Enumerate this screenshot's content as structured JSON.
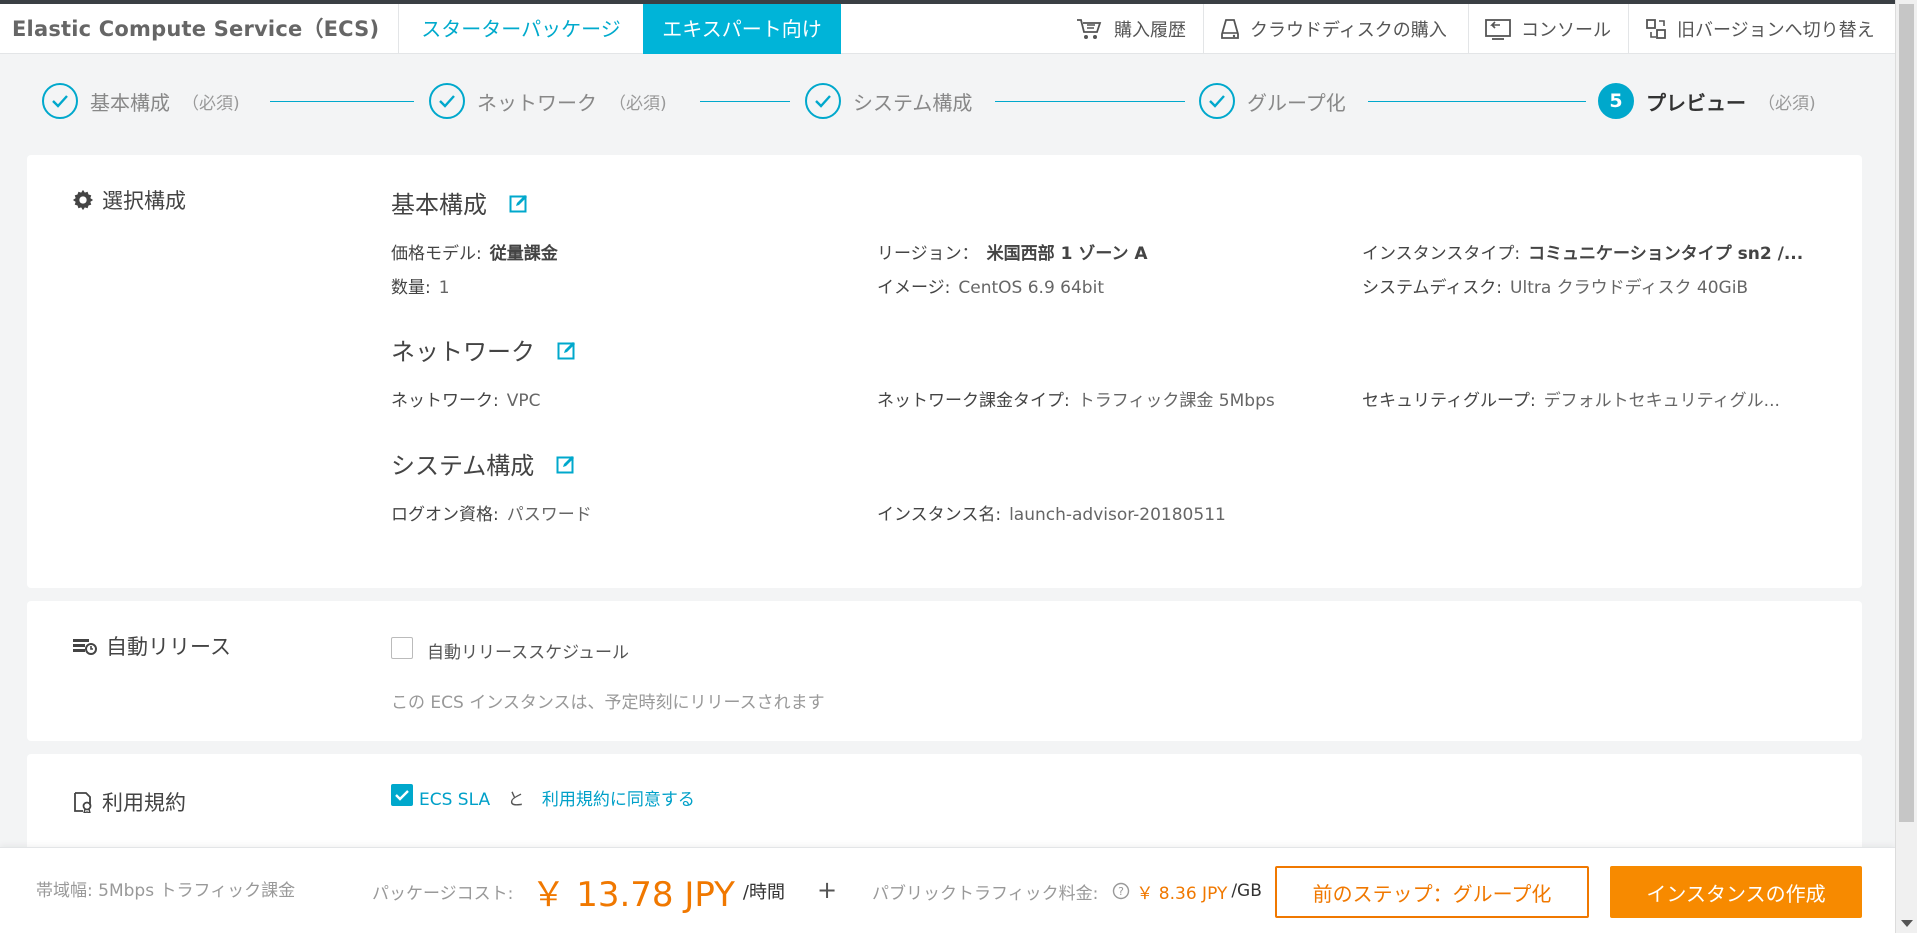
{
  "header": {
    "brand": "Elastic Compute Service（ECS)",
    "tab_starter": "スターターパッケージ",
    "tab_expert": "エキスパート向け",
    "nav_history": "購入履歴",
    "nav_disk": "クラウドディスクの購入",
    "nav_console": "コンソール",
    "nav_oldver": "旧バージョンへ切り替え"
  },
  "steps": [
    {
      "label": "基本構成",
      "req": "（必須)",
      "state": "done"
    },
    {
      "label": "ネットワーク",
      "req": "（必須)",
      "state": "done"
    },
    {
      "label": "システム構成",
      "req": "",
      "state": "done"
    },
    {
      "label": "グループ化",
      "req": "",
      "state": "done"
    },
    {
      "number": "5",
      "label": "プレビュー",
      "req": "（必須)",
      "state": "active"
    }
  ],
  "selected": {
    "title": "選択構成",
    "basic": {
      "title": "基本構成",
      "price_model_label": "価格モデル:",
      "price_model_value": "従量課金",
      "region_label": "リージョン：",
      "region_value": "米国西部 1 ゾーン A",
      "instance_type_label": "インスタンスタイプ:",
      "instance_type_value": "コミュニケーションタイプ sn2 /...",
      "quantity_label": "数量:",
      "quantity_value": "1",
      "image_label": "イメージ:",
      "image_value": "CentOS 6.9 64bit",
      "system_disk_label": "システムディスク:",
      "system_disk_value": "Ultra クラウドディスク 40GiB"
    },
    "network": {
      "title": "ネットワーク",
      "network_label": "ネットワーク:",
      "network_value": "VPC",
      "billing_label": "ネットワーク課金タイプ:",
      "billing_value": "トラフィック課金 5Mbps",
      "security_label": "セキュリティグループ:",
      "security_value": "デフォルトセキュリティグル..."
    },
    "system": {
      "title": "システム構成",
      "logon_label": "ログオン資格:",
      "logon_value": "パスワード",
      "instance_name_label": "インスタンス名:",
      "instance_name_value": "launch-advisor-20180511"
    }
  },
  "auto_release": {
    "title": "自動リリース",
    "checkbox_label": "自動リリーススケジュール",
    "checked": false,
    "note": "この ECS インスタンスは、予定時刻にリリースされます"
  },
  "terms": {
    "title": "利用規約",
    "checked": true,
    "sla_link": "ECS SLA",
    "and": "と",
    "terms_link": "利用規約に同意する"
  },
  "footer": {
    "bandwidth": "帯域幅:  5Mbps トラフィック課金",
    "package_label": "パッケージコスト:",
    "package_price": "￥ 13.78 JPY",
    "package_unit": "/時間",
    "plus": "+",
    "traffic_label": "パブリックトラフィック料金:",
    "traffic_price": "￥ 8.36 JPY",
    "traffic_unit": "/GB",
    "prev_button": "前のステップ：グループ化",
    "create_button": "インスタンスの作成"
  },
  "colors": {
    "accent": "#00b4d8",
    "orange": "#f78a00"
  }
}
